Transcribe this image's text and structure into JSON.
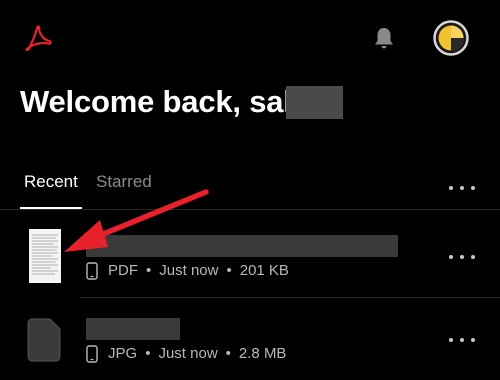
{
  "header": {
    "logo_icon": "adobe-acrobat-logo",
    "notifications_icon": "bell-icon",
    "avatar_icon": "user-avatar"
  },
  "welcome": {
    "title": "Welcome back, sahil"
  },
  "tabs": [
    {
      "label": "Recent",
      "active": true
    },
    {
      "label": "Starred",
      "active": false
    }
  ],
  "files": [
    {
      "name": "",
      "type": "PDF",
      "time": "Just now",
      "size": "201 KB",
      "device_icon": "phone-icon",
      "thumbnail": "document-thumbnail"
    },
    {
      "name": "",
      "type": "JPG",
      "time": "Just now",
      "size": "2.8 MB",
      "device_icon": "phone-icon",
      "thumbnail": "file-icon"
    }
  ],
  "separator": "•",
  "colors": {
    "background": "#000000",
    "brand_red": "#e3252b",
    "avatar_yellow": "#f2c12e",
    "annotation_arrow": "#e8212a"
  }
}
